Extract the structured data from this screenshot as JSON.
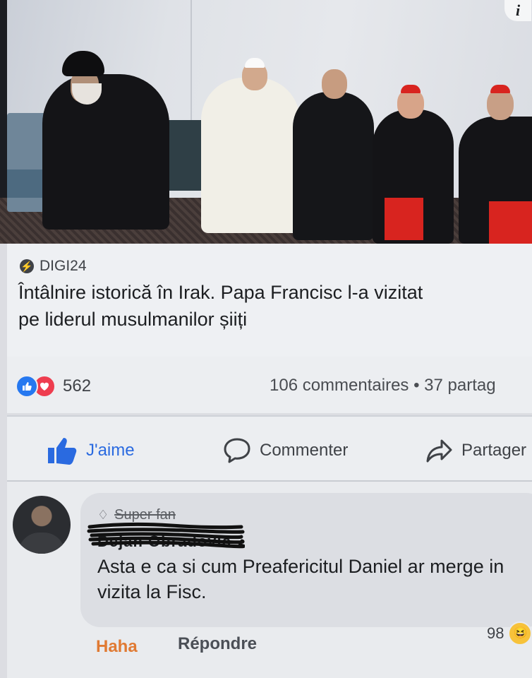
{
  "photo": {
    "info_icon": "i"
  },
  "preview": {
    "source_icon": "bolt-icon",
    "source": "DIGI24",
    "headline_line1": "Întâlnire istorică în Irak. Papa Francisc l-a vizitat",
    "headline_line2": "pe liderul musulmanilor șiiți"
  },
  "stats": {
    "reactions": [
      "like",
      "love"
    ],
    "reaction_count": "562",
    "comments_shares": "106 commentaires • 37 partag"
  },
  "actions": {
    "like": "J'aime",
    "comment": "Commenter",
    "share": "Partager"
  },
  "comment": {
    "badge": "Super fan",
    "author": "Dejan Obradovic",
    "text": "Asta e ca si cum Preafericitul Daniel ar merge in vizita la Fisc.",
    "haha_label": "Haha",
    "reply_label": "Répondre",
    "reaction_count": "98"
  },
  "colors": {
    "like_blue": "#2678f0",
    "love_red": "#ee3d4f",
    "haha_orange": "#e07a33"
  }
}
